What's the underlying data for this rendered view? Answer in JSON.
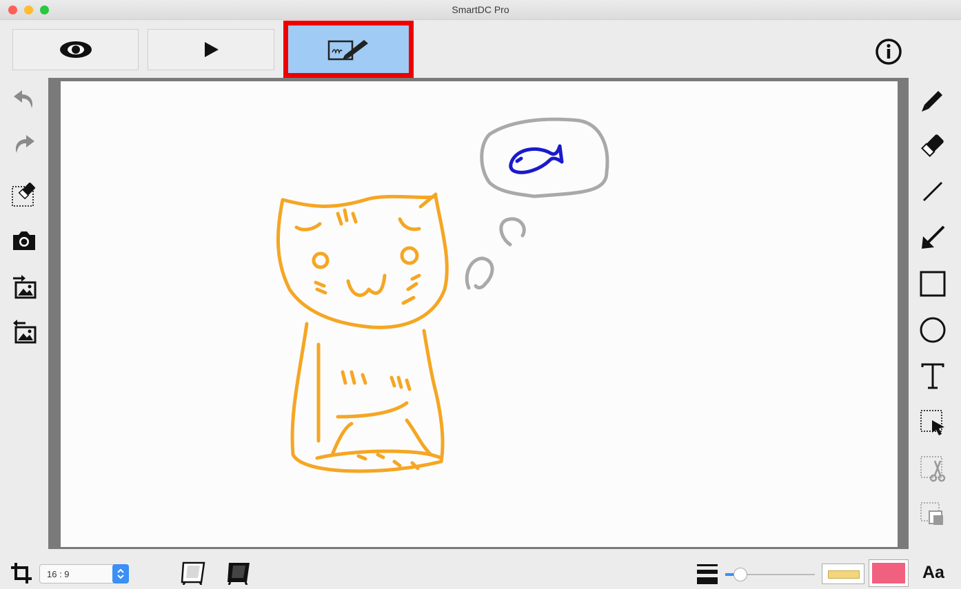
{
  "window": {
    "title": "SmartDC Pro",
    "traffic_lights": {
      "close": "#fe5f57",
      "minimize": "#febc2e",
      "zoom": "#28c840"
    }
  },
  "top_toolbar": {
    "buttons": [
      {
        "name": "preview-eye-icon"
      },
      {
        "name": "play-icon"
      },
      {
        "name": "whiteboard-pen-icon",
        "selected": true,
        "selected_color": "#9fcbf5"
      }
    ],
    "highlight_color": "#ee0000",
    "info_icon": "info-icon"
  },
  "left_tools": [
    "undo-icon",
    "redo-icon",
    "clear-selection-icon",
    "camera-icon",
    "import-image-icon",
    "export-image-icon"
  ],
  "right_tools": [
    "pencil-icon",
    "eraser-icon",
    "line-icon",
    "arrow-icon",
    "rectangle-icon",
    "circle-icon",
    "text-icon",
    "select-icon",
    "cut-icon",
    "copy-icon"
  ],
  "bottom_bar": {
    "aspect_ratio_value": "16 : 9",
    "font_label": "Aa",
    "pen_width_level": 0.08,
    "fill_color": "#f3d67b",
    "stroke_color": "#f26080"
  },
  "drawing": {
    "cat_color": "#f5a623",
    "bubble_color": "#a9a9a9",
    "fish_color": "#1a1acc"
  }
}
